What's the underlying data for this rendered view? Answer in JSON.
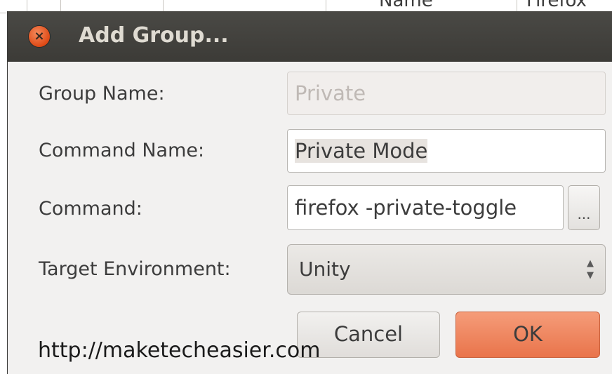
{
  "background": {
    "column_headers": [
      "Name",
      "Firefox"
    ]
  },
  "dialog": {
    "title": "Add Group...",
    "close_icon": "close-icon",
    "fields": {
      "group_name": {
        "label": "Group Name:",
        "placeholder": "Private",
        "disabled": true
      },
      "command_name": {
        "label": "Command Name:",
        "value": "Private Mode"
      },
      "command": {
        "label": "Command:",
        "value": "firefox -private-toggle",
        "browse_label": "..."
      },
      "target_environment": {
        "label": "Target Environment:",
        "selected": "Unity"
      }
    },
    "buttons": {
      "cancel": "Cancel",
      "ok": "OK"
    }
  },
  "colors": {
    "titlebar": "#3c3b37",
    "close_button": "#df4a16",
    "ok_button": "#e9744b",
    "dialog_bg": "#f2f1f0"
  },
  "watermark": "http://maketecheasier.com"
}
